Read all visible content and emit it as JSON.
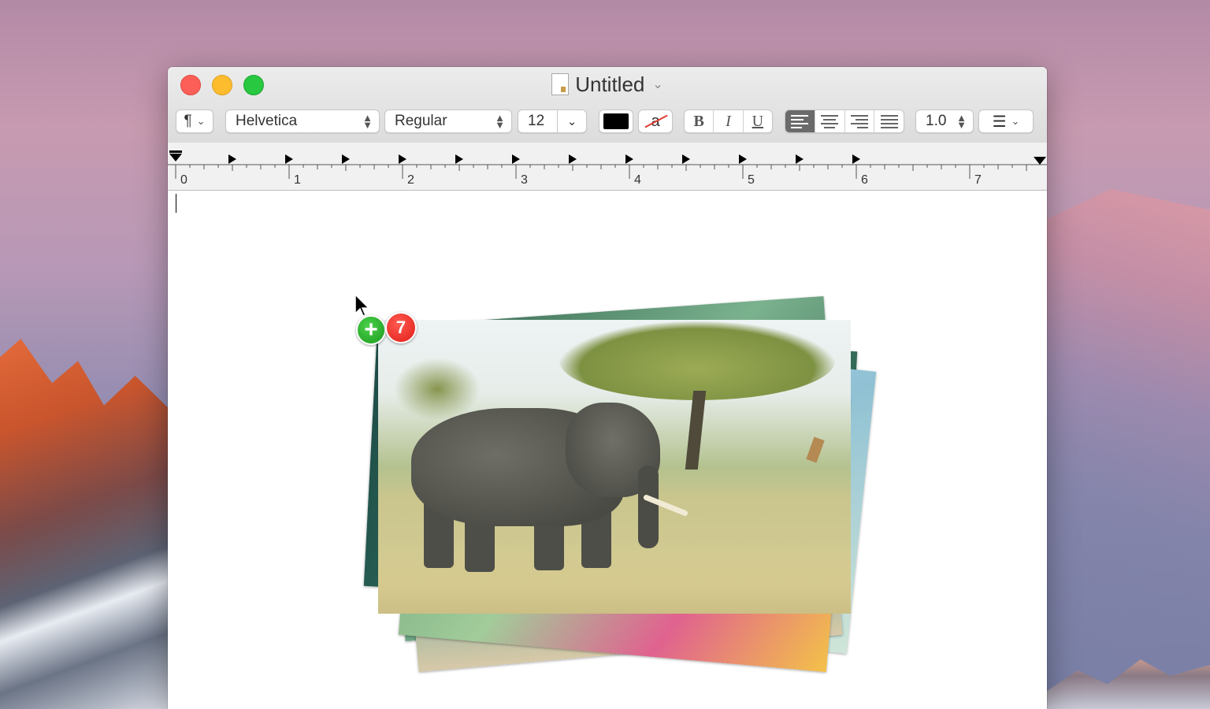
{
  "window": {
    "title": "Untitled",
    "title_chevron": "⌄"
  },
  "toolbar": {
    "paragraph_style": "¶",
    "font_family": "Helvetica",
    "font_style": "Regular",
    "font_size": "12",
    "bold": "B",
    "italic": "I",
    "underline": "U",
    "text_color": "#000000",
    "background_color_glyph": "a",
    "line_spacing": "1.0",
    "list_glyph": "☰"
  },
  "ruler": {
    "numbers": [
      "0",
      "1",
      "2",
      "3",
      "4",
      "5",
      "6",
      "7"
    ]
  },
  "drag": {
    "item_count": "7",
    "plus": "+"
  },
  "icons": {
    "text_color": "color-swatch-icon",
    "align_left": "align-left-icon",
    "align_center": "align-center-icon",
    "align_right": "align-right-icon",
    "align_justify": "align-justify-icon",
    "list": "list-bullets-icon"
  }
}
